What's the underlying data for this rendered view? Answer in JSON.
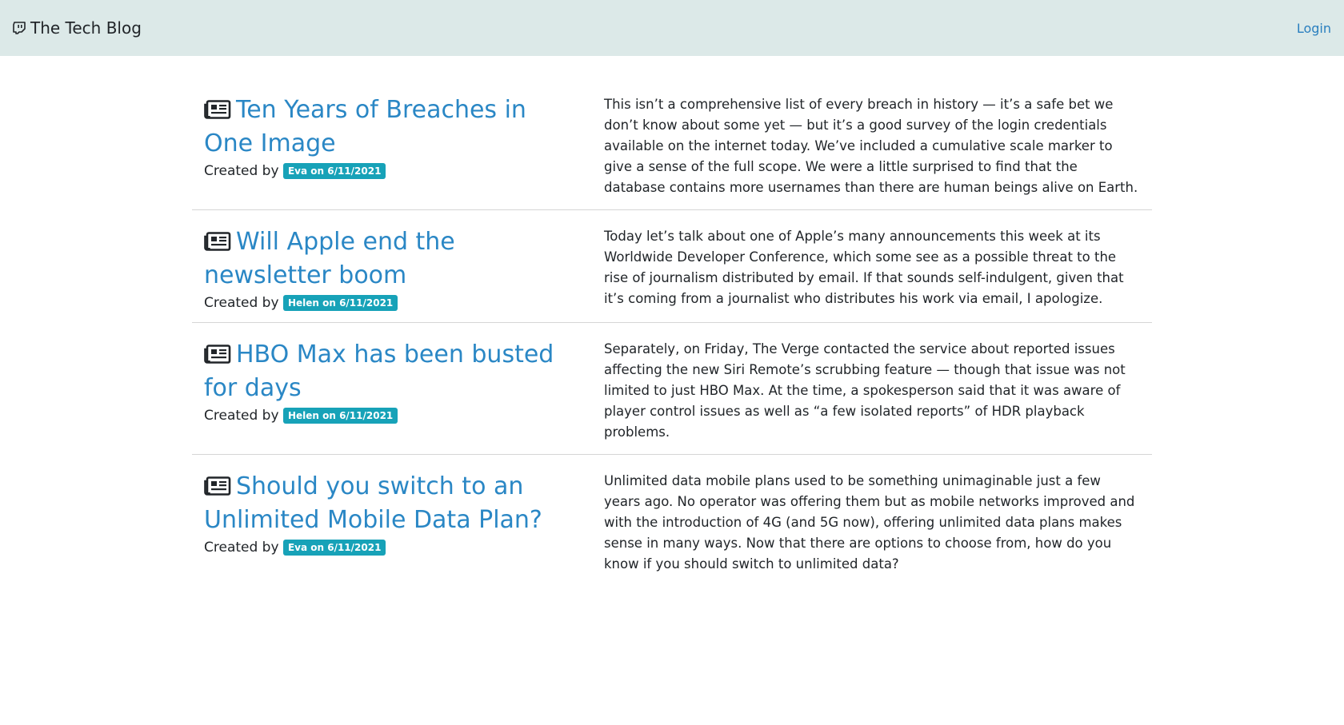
{
  "header": {
    "brand": "The Tech Blog",
    "login": "Login"
  },
  "posts": [
    {
      "title": "Ten Years of Breaches in One Image",
      "created_by": "Created by",
      "badge": "Eva on 6/11/2021",
      "body": "This isn’t a comprehensive list of every breach in history — it’s a safe bet we don’t know about some yet — but it’s a good survey of the login credentials available on the internet today. We’ve included a cumulative scale marker to give a sense of the full scope. We were a little surprised to find that the database contains more usernames than there are human beings alive on Earth."
    },
    {
      "title": "Will Apple end the newsletter boom",
      "created_by": "Created by",
      "badge": "Helen on 6/11/2021",
      "body": "Today let’s talk about one of Apple’s many announcements this week at its Worldwide Developer Conference, which some see as a possible threat to the rise of journalism distributed by email. If that sounds self-indulgent, given that it’s coming from a journalist who distributes his work via email, I apologize."
    },
    {
      "title": "HBO Max has been busted for days",
      "created_by": "Created by",
      "badge": "Helen on 6/11/2021",
      "body": "Separately, on Friday, The Verge contacted the service about reported issues affecting the new Siri Remote’s scrubbing feature — though that issue was not limited to just HBO Max. At the time, a spokesperson said that it was aware of player control issues as well as “a few isolated reports” of HDR playback problems."
    },
    {
      "title": "Should you switch to an Unlimited Mobile Data Plan?",
      "created_by": "Created by",
      "badge": "Eva on 6/11/2021",
      "body": "Unlimited data mobile plans used to be something unimaginable just a few years ago. No operator was offering them but as mobile networks improved and with the introduction of 4G (and 5G now), offering unlimited data plans makes sense in many ways. Now that there are options to choose from, how do you know if you should switch to unlimited data?"
    }
  ]
}
